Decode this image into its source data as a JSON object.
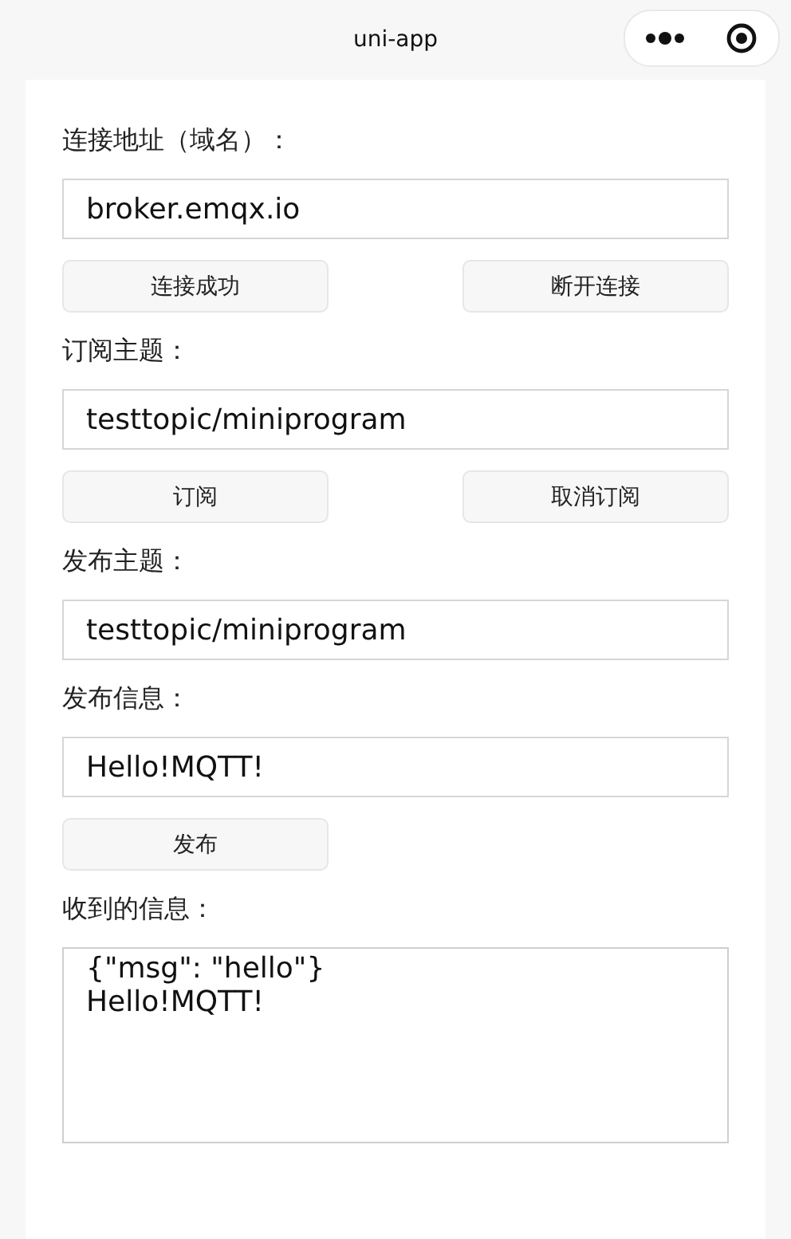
{
  "nav": {
    "title": "uni-app"
  },
  "sections": [
    {
      "kind": "label",
      "text": "连接地址（域名）："
    },
    {
      "kind": "field",
      "value": "broker.emqx.io"
    },
    {
      "kind": "buttons",
      "buttons": [
        "连接成功",
        "断开连接"
      ]
    },
    {
      "kind": "label",
      "text": "订阅主题："
    },
    {
      "kind": "field",
      "value": "testtopic/miniprogram"
    },
    {
      "kind": "buttons",
      "buttons": [
        "订阅",
        "取消订阅"
      ]
    },
    {
      "kind": "label",
      "text": "发布主题："
    },
    {
      "kind": "field",
      "value": "testtopic/miniprogram"
    },
    {
      "kind": "label",
      "text": "发布信息："
    },
    {
      "kind": "field",
      "value": "Hello!MQTT!"
    },
    {
      "kind": "buttons",
      "buttons": [
        "发布"
      ]
    },
    {
      "kind": "label",
      "text": "收到的信息："
    },
    {
      "kind": "textarea",
      "lines": [
        "{\"msg\": \"hello\"}",
        "Hello!MQTT!"
      ]
    }
  ]
}
